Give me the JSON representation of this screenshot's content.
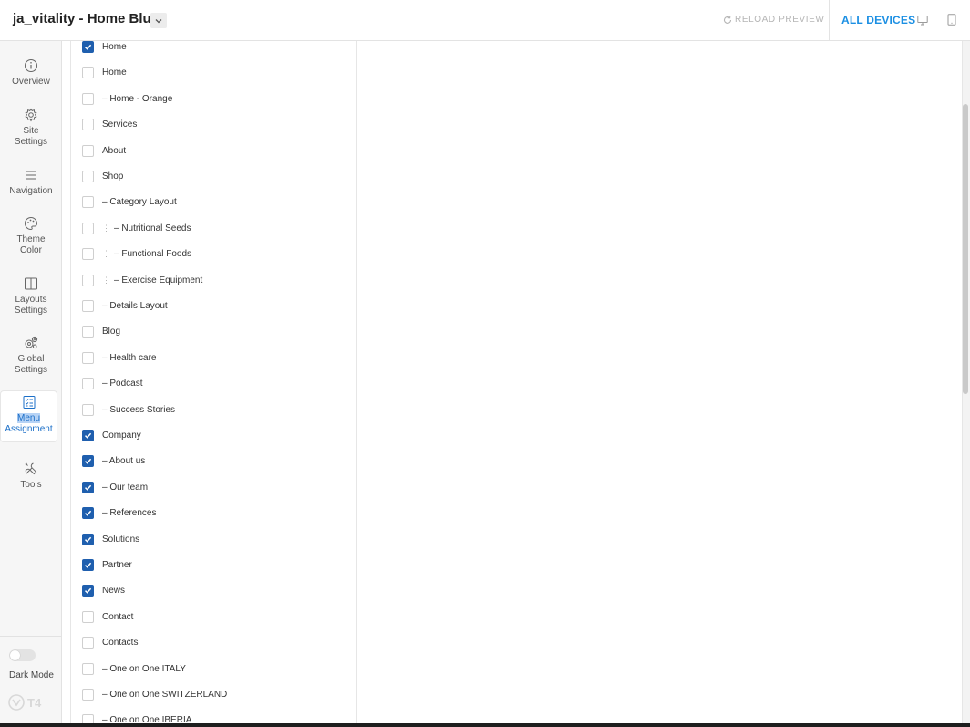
{
  "header": {
    "site_title": "ja_vitality - Home Blue",
    "reload_label": "RELOAD PREVIEW",
    "all_devices_label": "ALL DEVICES"
  },
  "sidebar": {
    "items": [
      {
        "label": "Overview",
        "icon": "info-icon"
      },
      {
        "label": "Site\nSettings",
        "icon": "gear-icon"
      },
      {
        "label": "Navigation",
        "icon": "menu-icon"
      },
      {
        "label": "Theme\nColor",
        "icon": "palette-icon"
      },
      {
        "label": "Layouts\nSettings",
        "icon": "layout-icon"
      },
      {
        "label": "Global\nSettings",
        "icon": "gears-icon"
      },
      {
        "label": "Menu\nAssignment",
        "icon": "checklist-icon",
        "active": true
      },
      {
        "label": "Tools",
        "icon": "tools-icon"
      }
    ],
    "dark_mode_label": "Dark Mode",
    "dark_mode_on": false,
    "logo_text": "T4"
  },
  "menu_items": [
    {
      "label": "Home",
      "checked": true
    },
    {
      "label": "Home",
      "checked": false
    },
    {
      "label": "– Home - Orange",
      "checked": false
    },
    {
      "label": "Services",
      "checked": false
    },
    {
      "label": "About",
      "checked": false
    },
    {
      "label": "Shop",
      "checked": false
    },
    {
      "label": "– Category Layout",
      "checked": false
    },
    {
      "label": "– Nutritional Seeds",
      "checked": false,
      "nested": true
    },
    {
      "label": "– Functional Foods",
      "checked": false,
      "nested": true
    },
    {
      "label": "– Exercise Equipment",
      "checked": false,
      "nested": true
    },
    {
      "label": "– Details Layout",
      "checked": false
    },
    {
      "label": "Blog",
      "checked": false
    },
    {
      "label": "– Health care",
      "checked": false
    },
    {
      "label": "– Podcast",
      "checked": false
    },
    {
      "label": "– Success Stories",
      "checked": false
    },
    {
      "label": "Company",
      "checked": true
    },
    {
      "label": "– About us",
      "checked": true
    },
    {
      "label": "– Our team",
      "checked": true
    },
    {
      "label": "– References",
      "checked": true
    },
    {
      "label": "Solutions",
      "checked": true
    },
    {
      "label": "Partner",
      "checked": true
    },
    {
      "label": "News",
      "checked": true
    },
    {
      "label": "Contact",
      "checked": false
    },
    {
      "label": "Contacts",
      "checked": false
    },
    {
      "label": "– One on One ITALY",
      "checked": false
    },
    {
      "label": "– One on One SWITZERLAND",
      "checked": false
    },
    {
      "label": "– One on One IBERIA",
      "checked": false
    }
  ],
  "colors": {
    "accent": "#1b8fe3",
    "checkbox_checked": "#1f5fae",
    "active_nav_text": "#1b6fc8"
  }
}
